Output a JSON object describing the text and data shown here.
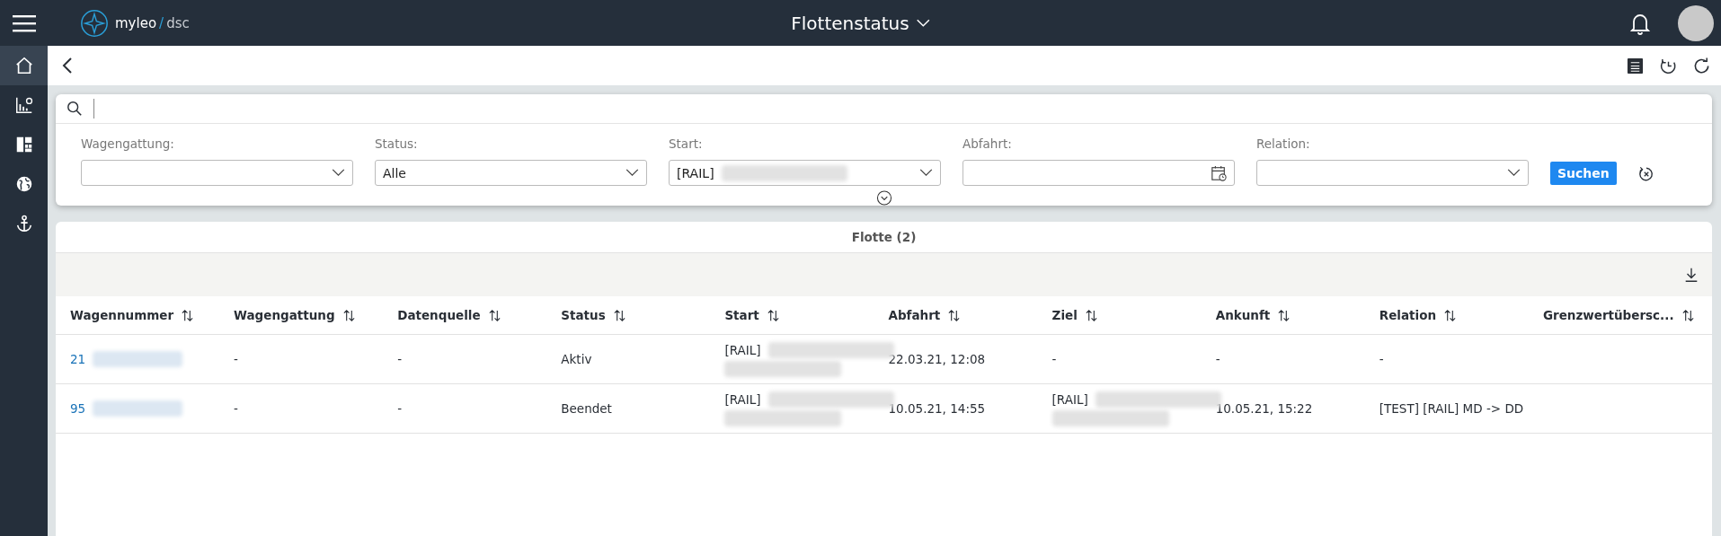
{
  "header": {
    "logo_name": "myleo",
    "logo_separator": "/",
    "logo_suffix": "dsc",
    "title": "Flottenstatus"
  },
  "sidebar": {
    "items": [
      {
        "kind": "home",
        "selected": true
      },
      {
        "kind": "chart",
        "selected": false
      },
      {
        "kind": "dashboard",
        "selected": false
      },
      {
        "kind": "globe",
        "selected": false
      },
      {
        "kind": "anchor",
        "selected": false
      }
    ]
  },
  "filters": [
    {
      "label": "Wagengattung:",
      "kind": "select"
    },
    {
      "label": "Status:",
      "kind": "select",
      "value": "Alle"
    },
    {
      "label": "Start:",
      "kind": "select",
      "value": "[RAIL]",
      "redacted": true
    },
    {
      "label": "Abfahrt:",
      "kind": "date"
    },
    {
      "label": "Relation:",
      "kind": "select"
    }
  ],
  "search_button": "Suchen",
  "table": {
    "title": "Flotte (2)",
    "columns": [
      "Wagennummer",
      "Wagengattung",
      "Datenquelle",
      "Status",
      "Start",
      "Abfahrt",
      "Ziel",
      "Ankunft",
      "Relation",
      "Grenzwertübersc..."
    ],
    "rows": [
      {
        "cells": [
          {
            "kind": "link",
            "text": "21",
            "redacted": true
          },
          {
            "kind": "text",
            "text": "-"
          },
          {
            "kind": "text",
            "text": "-"
          },
          {
            "kind": "text",
            "text": "Aktiv"
          },
          {
            "kind": "place",
            "text": "[RAIL]",
            "redacted": true
          },
          {
            "kind": "text",
            "text": "22.03.21, 12:08"
          },
          {
            "kind": "text",
            "text": "-"
          },
          {
            "kind": "text",
            "text": "-"
          },
          {
            "kind": "text",
            "text": "-"
          }
        ]
      },
      {
        "cells": [
          {
            "kind": "link",
            "text": "95",
            "redacted": true
          },
          {
            "kind": "text",
            "text": "-"
          },
          {
            "kind": "text",
            "text": "-"
          },
          {
            "kind": "text",
            "text": "Beendet"
          },
          {
            "kind": "place",
            "text": "[RAIL]",
            "redacted": true
          },
          {
            "kind": "text",
            "text": "10.05.21, 14:55"
          },
          {
            "kind": "place",
            "text": "[RAIL]",
            "redacted": true
          },
          {
            "kind": "text",
            "text": "10.05.21, 15:22"
          },
          {
            "kind": "text",
            "text": "[TEST] [RAIL] MD -> DD"
          }
        ]
      }
    ]
  }
}
